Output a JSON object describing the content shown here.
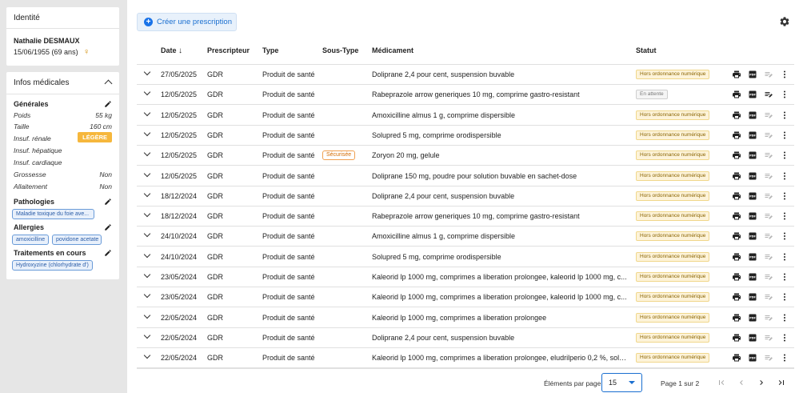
{
  "identity": {
    "title": "Identité",
    "name": "Nathalie DESMAUX",
    "dob": "15/06/1955 (69 ans)",
    "sex_icon": "female-icon"
  },
  "medical": {
    "title": "Infos médicales",
    "general_title": "Générales",
    "weight_label": "Poids",
    "weight_value": "55 kg",
    "height_label": "Taille",
    "height_value": "160 cm",
    "renal_label": "Insuf. rénale",
    "renal_value": "LÉGÈRE",
    "hepatic_label": "Insuf. hépatique",
    "cardiac_label": "Insuf. cardiaque",
    "pregnancy_label": "Grossesse",
    "pregnancy_value": "Non",
    "breastfeeding_label": "Allaitement",
    "breastfeeding_value": "Non",
    "pathologies_title": "Pathologies",
    "pathologies": [
      "Maladie toxique du foie ave..."
    ],
    "allergies_title": "Allergies",
    "allergies": [
      "amoxicilline",
      "povidone acetate"
    ],
    "treatments_title": "Traitements en cours",
    "treatments": [
      "Hydroxyzine (chlorhydrate d')"
    ]
  },
  "toolbar": {
    "create_label": "Créer une prescription",
    "settings_icon": "gear-icon"
  },
  "table": {
    "headers": {
      "date": "Date",
      "prescriber": "Prescripteur",
      "type": "Type",
      "subtype": "Sous-Type",
      "drug": "Médicament",
      "status": "Statut"
    },
    "rows": [
      {
        "date": "27/05/2025",
        "prescriber": "GDR",
        "type": "Produit de santé",
        "subtype": "",
        "drug": "Doliprane 2,4 pour cent, suspension buvable",
        "status": "Hors ordonnance numérique"
      },
      {
        "date": "12/05/2025",
        "prescriber": "GDR",
        "type": "Produit de santé",
        "subtype": "",
        "drug": "Rabeprazole arrow generiques 10 mg, comprime gastro-resistant",
        "status": "En attente"
      },
      {
        "date": "12/05/2025",
        "prescriber": "GDR",
        "type": "Produit de santé",
        "subtype": "",
        "drug": "Amoxicilline almus 1 g, comprime dispersible",
        "status": "Hors ordonnance numérique"
      },
      {
        "date": "12/05/2025",
        "prescriber": "GDR",
        "type": "Produit de santé",
        "subtype": "",
        "drug": "Solupred 5 mg, comprime orodispersible",
        "status": "Hors ordonnance numérique"
      },
      {
        "date": "12/05/2025",
        "prescriber": "GDR",
        "type": "Produit de santé",
        "subtype": "Sécurisée",
        "drug": "Zoryon 20 mg, gelule",
        "status": "Hors ordonnance numérique"
      },
      {
        "date": "12/05/2025",
        "prescriber": "GDR",
        "type": "Produit de santé",
        "subtype": "",
        "drug": "Doliprane 150 mg, poudre pour solution buvable en sachet-dose",
        "status": "Hors ordonnance numérique"
      },
      {
        "date": "18/12/2024",
        "prescriber": "GDR",
        "type": "Produit de santé",
        "subtype": "",
        "drug": "Doliprane 2,4 pour cent, suspension buvable",
        "status": "Hors ordonnance numérique"
      },
      {
        "date": "18/12/2024",
        "prescriber": "GDR",
        "type": "Produit de santé",
        "subtype": "",
        "drug": "Rabeprazole arrow generiques 10 mg, comprime gastro-resistant",
        "status": "Hors ordonnance numérique"
      },
      {
        "date": "24/10/2024",
        "prescriber": "GDR",
        "type": "Produit de santé",
        "subtype": "",
        "drug": "Amoxicilline almus 1 g, comprime dispersible",
        "status": "Hors ordonnance numérique"
      },
      {
        "date": "24/10/2024",
        "prescriber": "GDR",
        "type": "Produit de santé",
        "subtype": "",
        "drug": "Solupred 5 mg, comprime orodispersible",
        "status": "Hors ordonnance numérique"
      },
      {
        "date": "23/05/2024",
        "prescriber": "GDR",
        "type": "Produit de santé",
        "subtype": "",
        "drug": "Kaleorid lp 1000 mg, comprimes a liberation prolongee, kaleorid lp 1000 mg, c...",
        "status": "Hors ordonnance numérique"
      },
      {
        "date": "23/05/2024",
        "prescriber": "GDR",
        "type": "Produit de santé",
        "subtype": "",
        "drug": "Kaleorid lp 1000 mg, comprimes a liberation prolongee, kaleorid lp 1000 mg, c...",
        "status": "Hors ordonnance numérique"
      },
      {
        "date": "22/05/2024",
        "prescriber": "GDR",
        "type": "Produit de santé",
        "subtype": "",
        "drug": "Kaleorid lp 1000 mg, comprimes a liberation prolongee",
        "status": "Hors ordonnance numérique"
      },
      {
        "date": "22/05/2024",
        "prescriber": "GDR",
        "type": "Produit de santé",
        "subtype": "",
        "drug": "Doliprane 2,4 pour cent, suspension buvable",
        "status": "Hors ordonnance numérique"
      },
      {
        "date": "22/05/2024",
        "prescriber": "GDR",
        "type": "Produit de santé",
        "subtype": "",
        "drug": "Kaleorid lp 1000 mg, comprimes a liberation prolongee, eludrilperio 0,2 %, solu...",
        "status": "Hors ordonnance numérique"
      }
    ]
  },
  "pagination": {
    "per_page_label": "Éléments par page",
    "per_page_value": "15",
    "page_info": "Page 1 sur 2"
  },
  "colors": {
    "accent": "#1a73e8",
    "status_hors_bg": "#fdf3d9",
    "legere_badge": "#f6b73c",
    "secure_badge": "#d36a00"
  }
}
